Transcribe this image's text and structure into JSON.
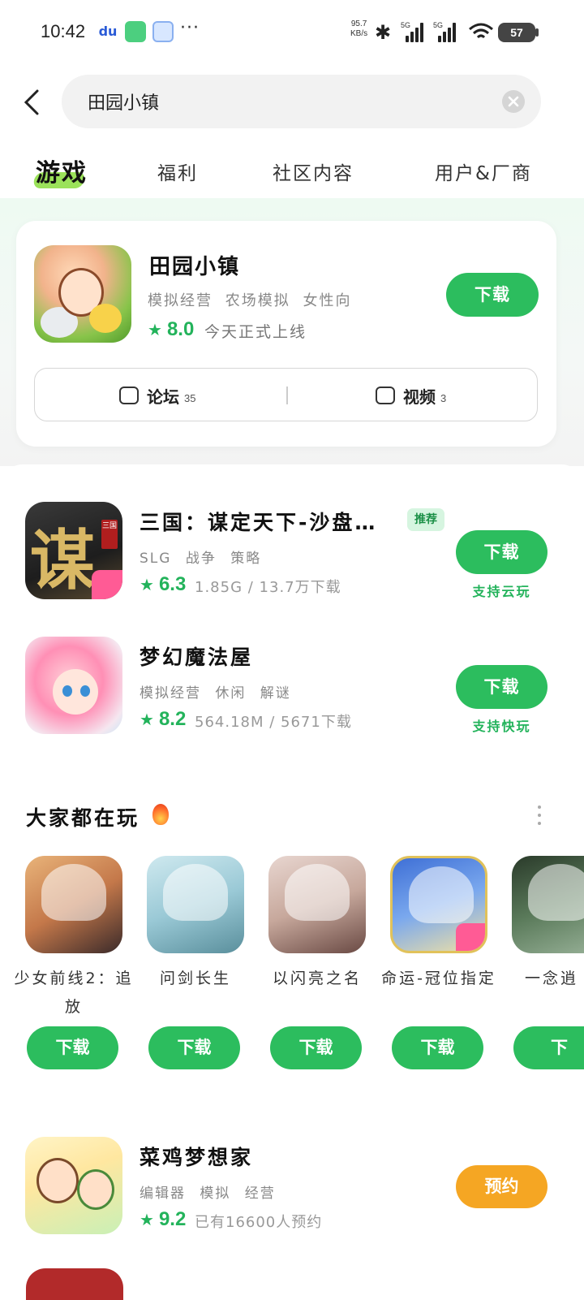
{
  "status_bar": {
    "time": "10:42",
    "net_speed_value": "95.7",
    "net_speed_unit": "KB/s",
    "signal1": "5G",
    "signal2": "5G",
    "wifi_sub": "7",
    "battery": "57",
    "icons": [
      "baidu-icon",
      "app-icon",
      "app-icon",
      "more-icon",
      "bluetooth-icon",
      "signal-icon",
      "signal-icon",
      "wifi-icon",
      "battery-icon"
    ]
  },
  "search": {
    "value": "田园小镇"
  },
  "tabs": [
    {
      "label": "游戏",
      "active": true
    },
    {
      "label": "福利"
    },
    {
      "label": "社区内容"
    },
    {
      "label": "用户&厂商"
    }
  ],
  "hero": {
    "title": "田园小镇",
    "tags": "模拟经营 农场模拟 女性向",
    "rating": "8.0",
    "subtitle": "今天正式上线",
    "download": "下载",
    "links": [
      {
        "label": "论坛",
        "count": "35"
      },
      {
        "label": "视频",
        "count": "3"
      }
    ]
  },
  "results": [
    {
      "title": "三国：谋定天下-沙盘…",
      "badge": "推荐",
      "tags": "SLG 战争 策略",
      "rating": "6.3",
      "meta": "1.85G / 13.7万下载",
      "download": "下载",
      "note": "支持云玩",
      "icon_text": "谋",
      "icon_tag": "三国"
    },
    {
      "title": "梦幻魔法屋",
      "tags": "模拟经营 休闲 解谜",
      "rating": "8.2",
      "meta": "564.18M / 5671下载",
      "download": "下载",
      "note": "支持快玩"
    }
  ],
  "popular": {
    "title": "大家都在玩",
    "items": [
      {
        "name": "少女前线2：追放",
        "download": "下载"
      },
      {
        "name": "问剑长生",
        "download": "下载"
      },
      {
        "name": "以闪亮之名",
        "download": "下载"
      },
      {
        "name": "命运-冠位指定",
        "download": "下载"
      },
      {
        "name": "一念逍",
        "download": "下"
      }
    ]
  },
  "bottom_item": {
    "title": "菜鸡梦想家",
    "tags": "编辑器 模拟 经营",
    "rating": "9.2",
    "meta": "已有16600人预约",
    "button": "预约"
  },
  "colors": {
    "primary_green": "#2cbd5e",
    "rating_green": "#23b35b",
    "reserve_orange": "#f5a623"
  }
}
